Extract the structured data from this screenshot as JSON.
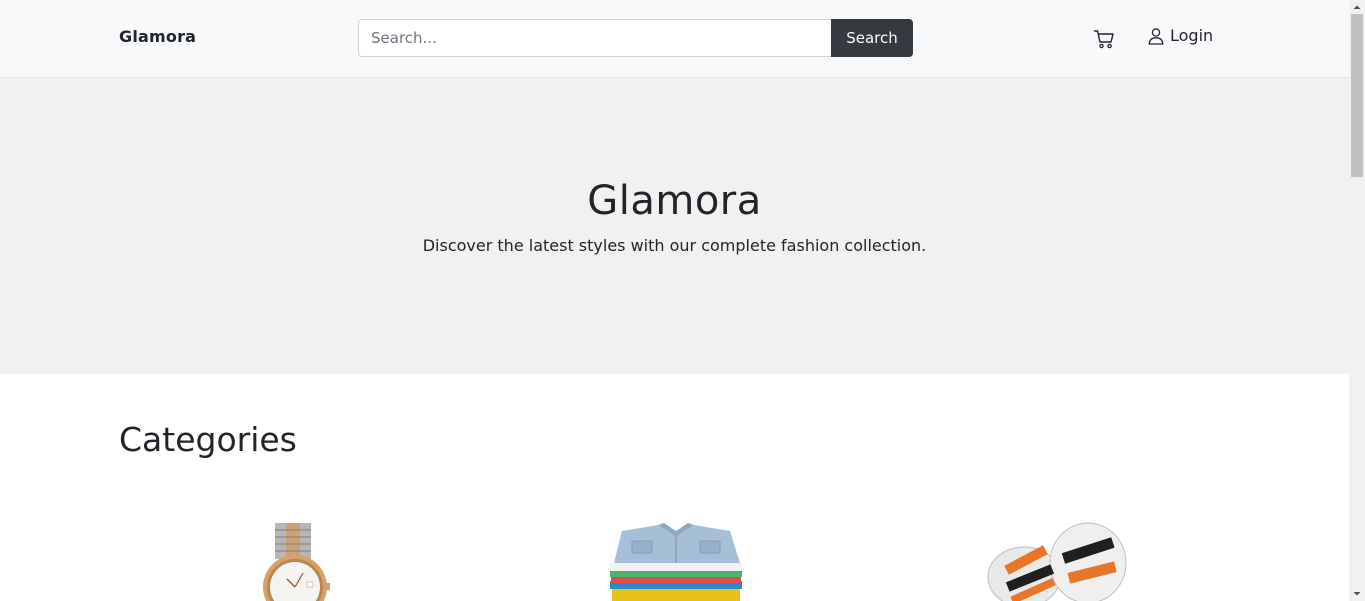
{
  "navbar": {
    "brand": "Glamora",
    "search_placeholder": "Search...",
    "search_button": "Search",
    "cart_icon": "cart-icon",
    "login_icon": "user-icon",
    "login_label": "Login"
  },
  "hero": {
    "title": "Glamora",
    "subtitle": "Discover the latest styles with our complete fashion collection."
  },
  "categories": {
    "heading": "Categories",
    "items": [
      {
        "image": "watch"
      },
      {
        "image": "folded-shirts"
      },
      {
        "image": "sandals"
      }
    ]
  },
  "colors": {
    "navbar_bg": "#f8f9fa",
    "hero_bg": "#f1f1f1",
    "button_dark": "#343a40",
    "text": "#212529"
  }
}
